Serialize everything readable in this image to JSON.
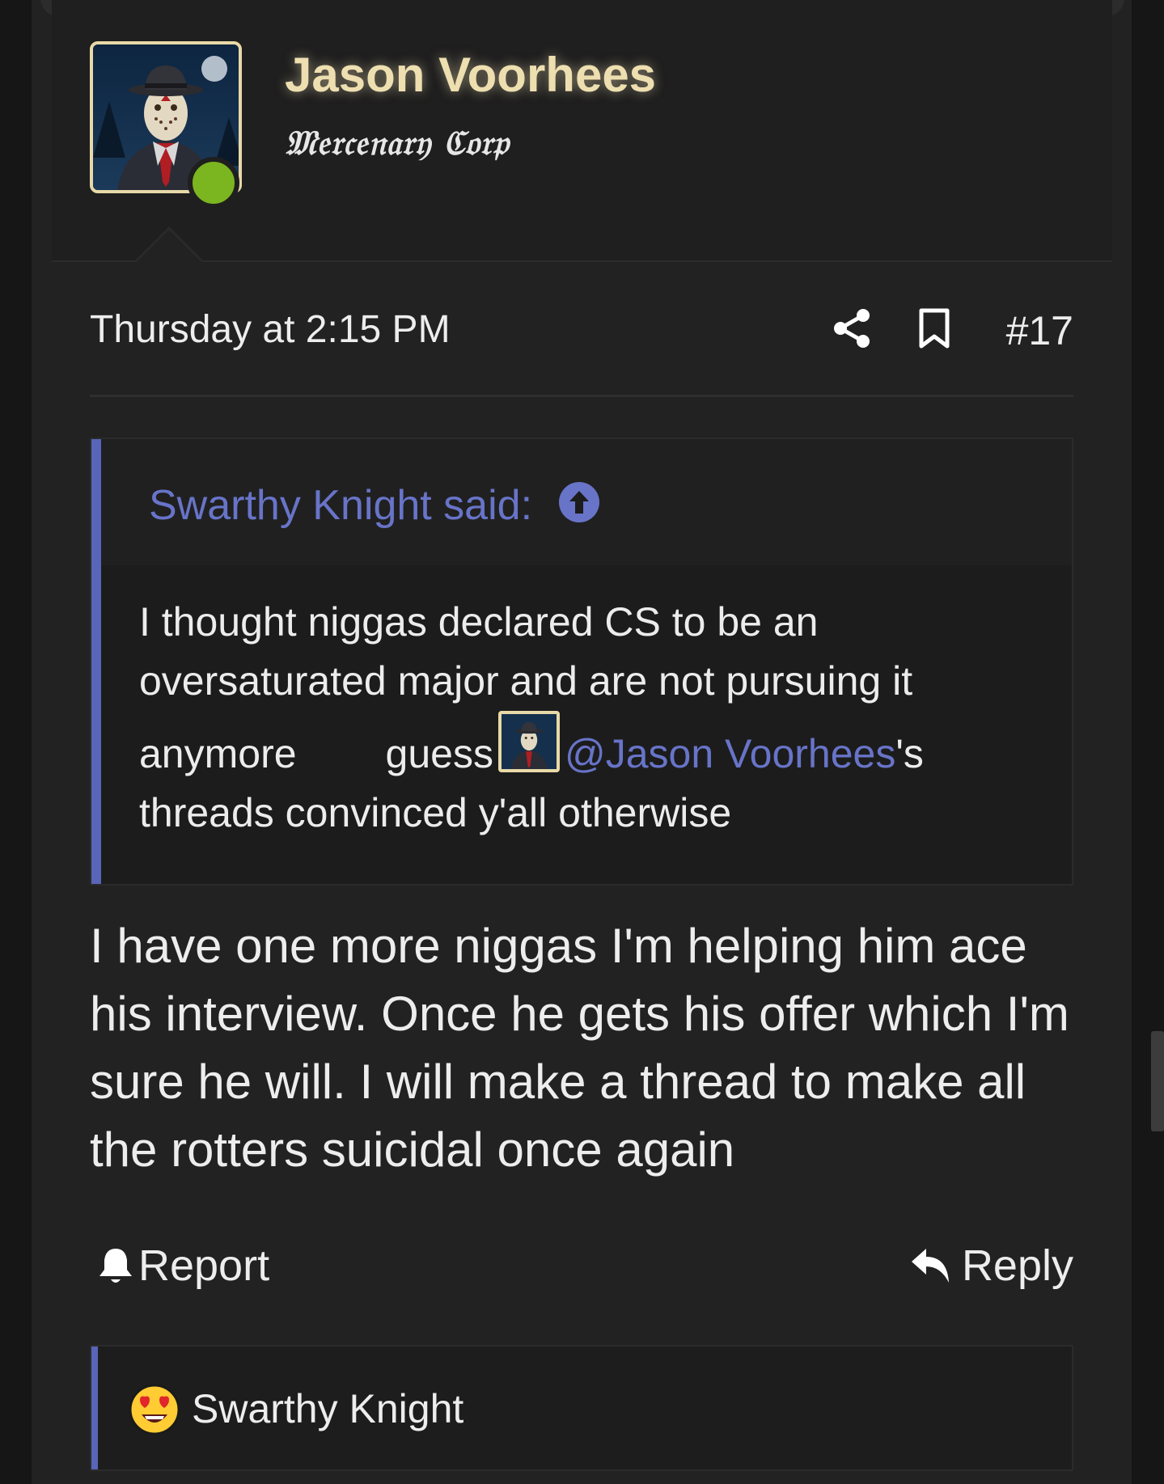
{
  "post": {
    "author": {
      "name": "Jason Voorhees",
      "title": "𝔐𝔢𝔯𝔠𝔢𝔫𝔞𝔯𝔶 ℭ𝔬𝔯𝔭",
      "avatar_icon": "masked-man-avatar",
      "online": true,
      "name_color": "#eedfb0"
    },
    "meta": {
      "date": "Thursday at 2:15 PM",
      "number": "#17",
      "share_icon": "share-icon",
      "bookmark_icon": "bookmark-icon"
    },
    "quote": {
      "author_said": "Swarthy Knight said:",
      "arrow_icon": "arrow-up-circle-icon",
      "line1": "I thought niggas declared CS to be an",
      "line2": "oversaturated major and are not pursuing it",
      "line3_start": "anymore",
      "line3_mid": "guess",
      "mention": "@Jason Voorhees",
      "mention_suffix": "'s",
      "line4": "threads convinced y'all otherwise"
    },
    "body": "I have one more niggas I'm helping him ace his interview. Once he gets his offer which I'm sure he will. I will make a thread to make all the rotters suicidal once again",
    "actions": {
      "report_label": "Report",
      "reply_label": "Reply"
    },
    "reactions": {
      "emoji": "heart-eyes-emoji",
      "user": "Swarthy Knight"
    }
  },
  "colors": {
    "background": "#161616",
    "panel": "#222222",
    "accent": "#5965b8",
    "link": "#6874c8",
    "online": "#7bb520",
    "avatar_border": "#e8d9a8"
  }
}
